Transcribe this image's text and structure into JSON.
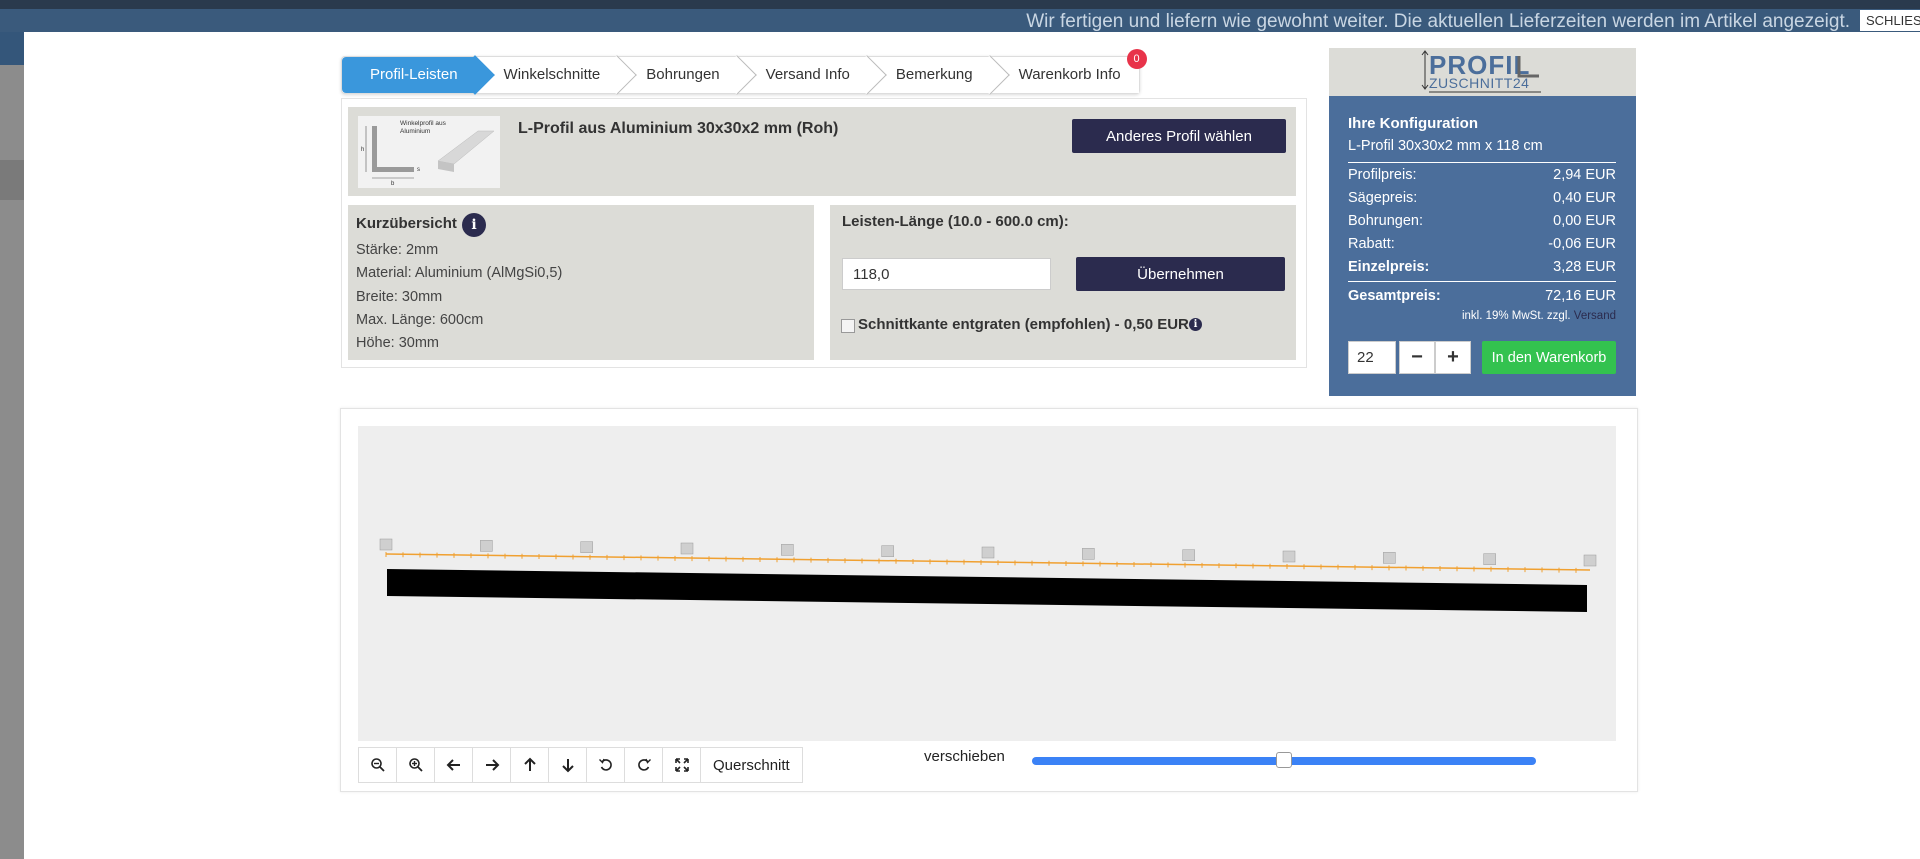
{
  "banner": {
    "text": "Wir fertigen und liefern wie gewohnt weiter. Die aktuellen Lieferzeiten werden im Artikel angezeigt.",
    "close_label": "SCHLIES"
  },
  "steps": [
    {
      "label": "Profil-Leisten",
      "active": true
    },
    {
      "label": "Winkelschnitte"
    },
    {
      "label": "Bohrungen"
    },
    {
      "label": "Versand Info"
    },
    {
      "label": "Bemerkung"
    },
    {
      "label": "Warenkorb Info",
      "badge": "0"
    }
  ],
  "product": {
    "thumb_text_1": "Winkelprofil aus",
    "thumb_text_2": "Aluminium",
    "thumb_dim_h": "h",
    "thumb_dim_b": "b",
    "thumb_dim_s": "s",
    "title": "L-Profil aus Aluminium 30x30x2 mm (Roh)",
    "change_button": "Anderes Profil wählen"
  },
  "overview": {
    "title": "Kurzübersicht",
    "info_icon": "i",
    "items": [
      "Stärke: 2mm",
      "Material: Aluminium (AlMgSi0,5)",
      "Breite: 30mm",
      "Max. Länge: 600cm",
      "Höhe: 30mm"
    ]
  },
  "length": {
    "label": "Leisten-Länge (10.0 - 600.0 cm):",
    "value": "118,0",
    "apply_button": "Übernehmen",
    "deburr_label": "Schnittkante entgraten (empfohlen) - 0,50 EUR",
    "deburr_checked": false,
    "info_icon": "i"
  },
  "sidebar": {
    "logo_top": "PROFIL",
    "logo_bottom": "ZUSCHNITT24",
    "config_title": "Ihre Konfiguration",
    "config_sub": "L-Profil 30x30x2 mm x 118 cm",
    "prices": [
      {
        "label": "Profilpreis:",
        "value": "2,94 EUR"
      },
      {
        "label": "Sägepreis:",
        "value": "0,40 EUR"
      },
      {
        "label": "Bohrungen:",
        "value": "0,00 EUR"
      },
      {
        "label": "Rabatt:",
        "value": "-0,06 EUR"
      },
      {
        "label": "Einzelpreis:",
        "value": "3,28 EUR",
        "bold": true
      }
    ],
    "total": {
      "label": "Gesamtpreis:",
      "value": "72,16 EUR"
    },
    "vat_text": "inkl. 19% MwSt. zzgl.",
    "vat_link": "Versand",
    "quantity": "22",
    "minus": "−",
    "plus": "+",
    "cart_button": "In den Warenkorb"
  },
  "viewer": {
    "toolbar_text_button": "Querschnitt",
    "slider_label": "verschieben",
    "slider_value": 0.5
  },
  "colors": {
    "accent": "#3a97dc",
    "dark_button": "#2b2b4e",
    "sidebar": "#4b6e9b",
    "cart_button": "#33c24f",
    "badge": "#e8334a"
  }
}
